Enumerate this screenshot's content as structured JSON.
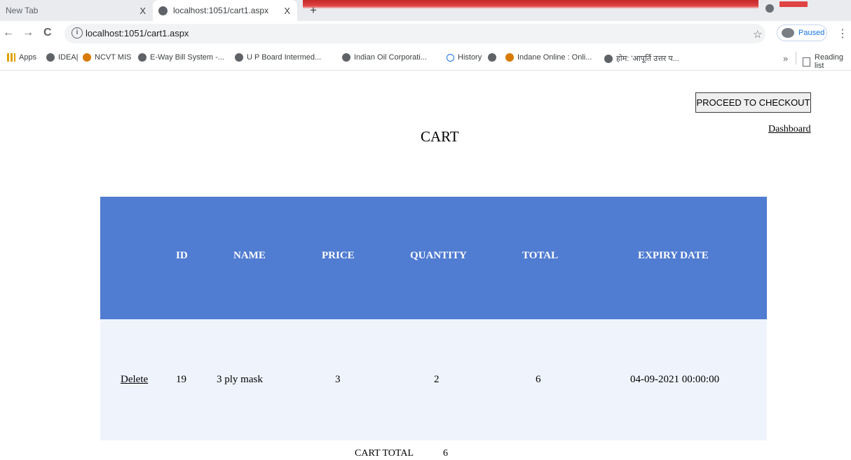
{
  "browser": {
    "tabs": [
      {
        "title": "New Tab",
        "close": "X"
      },
      {
        "title": "localhost:1051/cart1.aspx",
        "close": "X"
      }
    ],
    "new_tab": "+",
    "nav": {
      "back": "←",
      "forward": "→",
      "reload": "C"
    },
    "info_icon": "i",
    "url": "localhost:1051/cart1.aspx",
    "star": "☆",
    "profile": "Paused",
    "menu": "⋮",
    "bookmarks": [
      "Apps",
      "IDEA|",
      "NCVT MIS",
      "E-Way Bill System -...",
      "U P Board Intermed...",
      "Indian Oil Corporati...",
      "History",
      "",
      "Indane Online : Onli...",
      "होम: 'आपूर्ति उत्तर प..."
    ],
    "bookmarks_more": "»",
    "reading_list": "Reading list"
  },
  "page": {
    "checkout_label": "PROCEED TO CHECKOUT",
    "dashboard_label": "Dashboard",
    "title": "CART",
    "table": {
      "headers": [
        "ID",
        "NAME",
        "PRICE",
        "QUANTITY",
        "TOTAL",
        "EXPIRY DATE"
      ],
      "rows": [
        {
          "action": "Delete",
          "id": "19",
          "name": "3 ply mask",
          "price": "3",
          "quantity": "2",
          "total": "6",
          "expiry": "04-09-2021 00:00:00"
        }
      ],
      "header_color": "#507CD1",
      "row_color": "#EFF3FB"
    },
    "cart_total_label": "CART TOTAL",
    "cart_total_value": "6"
  }
}
